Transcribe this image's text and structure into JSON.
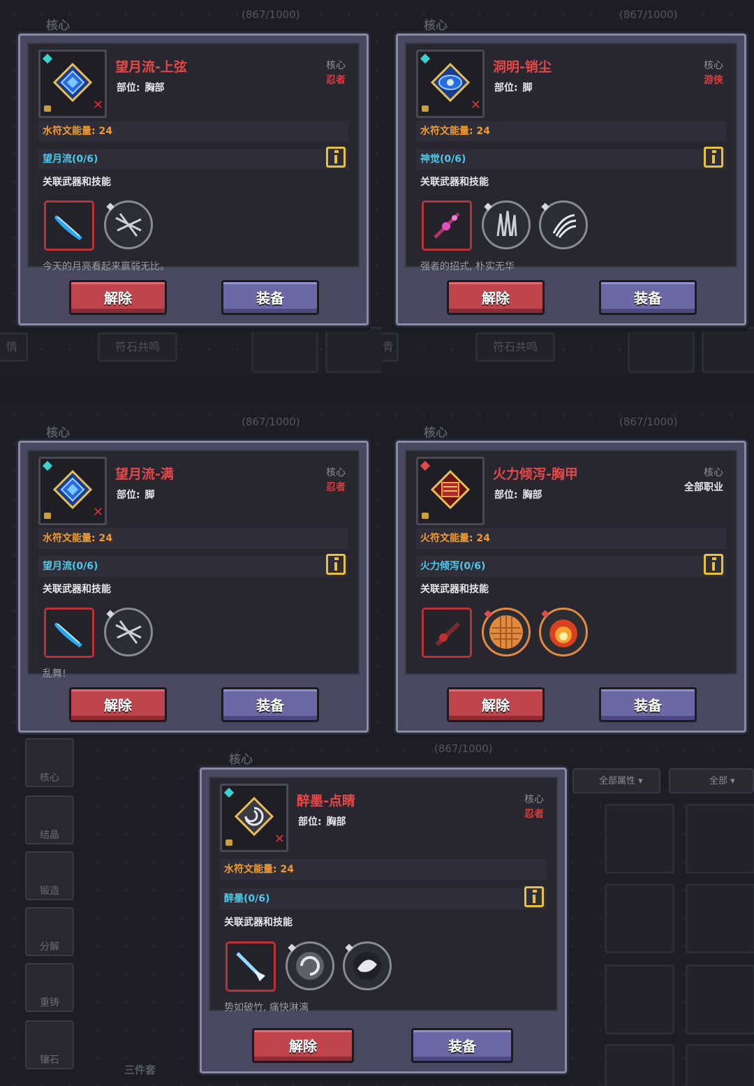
{
  "background": {
    "core_label": "核心",
    "count": "(867/1000)",
    "left_tab": "情",
    "left_tab_cropped": "青",
    "rune_resonance": "符石共鸣",
    "sidebar": [
      "核心",
      "结晶",
      "锻造",
      "分解",
      "重铸",
      "镶石"
    ],
    "three_piece": "三件套",
    "filter_all_attr": "全部属性",
    "filter_all": "全部"
  },
  "cards": [
    {
      "title": "望月流-上弦",
      "part_label": "部位:",
      "part": "胸部",
      "core": "核心",
      "class": "忍者",
      "energy": "水符文能量: 24",
      "set": "望月流(0/6)",
      "linked": "关联武器和技能",
      "desc": "今天的月亮看起来赢弱无比。",
      "release": "解除",
      "equip": "装备",
      "icon": "blue-diamond-core-icon"
    },
    {
      "title": "洞明-销尘",
      "part_label": "部位:",
      "part": "脚",
      "core": "核心",
      "class": "游侠",
      "energy": "水符文能量: 24",
      "set": "神觉(0/6)",
      "linked": "关联武器和技能",
      "desc": "强者的招式, 朴实无华",
      "release": "解除",
      "equip": "装备",
      "icon": "blue-eye-core-icon"
    },
    {
      "title": "望月流-满",
      "part_label": "部位:",
      "part": "脚",
      "core": "核心",
      "class": "忍者",
      "energy": "水符文能量: 24",
      "set": "望月流(0/6)",
      "linked": "关联武器和技能",
      "desc": "乱舞!",
      "release": "解除",
      "equip": "装备",
      "icon": "blue-diamond-core-icon"
    },
    {
      "title": "火力倾泻-胸甲",
      "part_label": "部位:",
      "part": "胸部",
      "core": "核心",
      "class": "全部职业",
      "energy": "火符文能量: 24",
      "set": "火力倾泻(0/6)",
      "linked": "关联武器和技能",
      "desc": "",
      "release": "解除",
      "equip": "装备",
      "icon": "red-fire-core-icon"
    },
    {
      "title": "醉墨-点睛",
      "part_label": "部位:",
      "part": "胸部",
      "core": "核心",
      "class": "忍者",
      "energy": "水符文能量: 24",
      "set": "醉墨(0/6)",
      "linked": "关联武器和技能",
      "desc": "势如破竹, 痛快淋漓",
      "release": "解除",
      "equip": "装备",
      "icon": "swirl-core-icon"
    }
  ]
}
